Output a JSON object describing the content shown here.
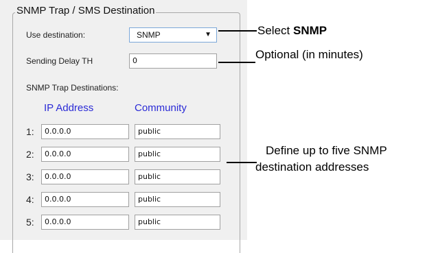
{
  "group": {
    "legend": "SNMP Trap / SMS Destination"
  },
  "use_destination": {
    "label": "Use destination:",
    "value": "SNMP",
    "arrow": "▼"
  },
  "sending_delay": {
    "label": "Sending Delay TH",
    "value": "0"
  },
  "trap_destinations": {
    "label": "SNMP Trap Destinations:",
    "columns": [
      "IP Address",
      "Community"
    ],
    "rows": [
      {
        "num": "1:",
        "ip": "0.0.0.0",
        "community": "public"
      },
      {
        "num": "2:",
        "ip": "0.0.0.0",
        "community": "public"
      },
      {
        "num": "3:",
        "ip": "0.0.0.0",
        "community": "public"
      },
      {
        "num": "4:",
        "ip": "0.0.0.0",
        "community": "public"
      },
      {
        "num": "5:",
        "ip": "0.0.0.0",
        "community": "public"
      }
    ]
  },
  "callouts": {
    "select_prefix": "Select ",
    "select_bold": "SNMP",
    "optional": "Optional (in minutes)",
    "define_line1": "Define up to five SNMP",
    "define_line2": "destination addresses"
  }
}
